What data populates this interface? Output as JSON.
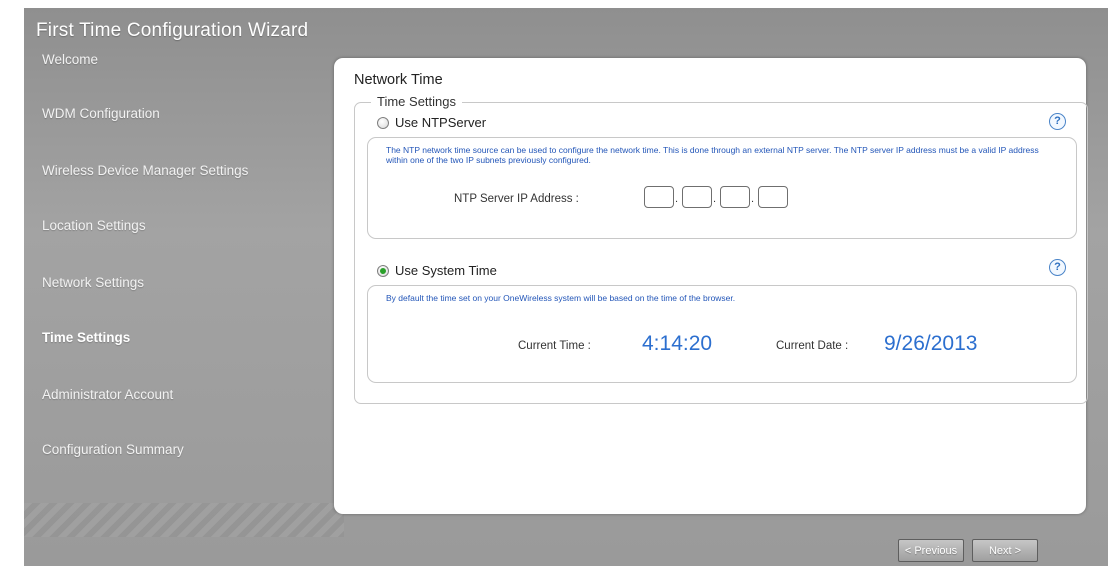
{
  "wizard": {
    "title": "First Time Configuration Wizard"
  },
  "nav": {
    "items": [
      {
        "label": "Welcome"
      },
      {
        "label": "WDM Configuration"
      },
      {
        "label": "Wireless Device Manager Settings"
      },
      {
        "label": "Location Settings"
      },
      {
        "label": "Network Settings"
      },
      {
        "label": "Time Settings",
        "active": true
      },
      {
        "label": "Administrator Account"
      },
      {
        "label": "Configuration Summary"
      }
    ]
  },
  "content": {
    "title": "Network Time",
    "legend": "Time Settings",
    "ntp": {
      "option_label": "Use NTPServer",
      "selected": false,
      "description": "The NTP network time source can be used to configure the network time. This is done through an external NTP server. The NTP server IP address must be a valid IP address within one of the two IP subnets previously configured.",
      "ip_label": "NTP Server IP Address :",
      "ip_octets": [
        "",
        "",
        "",
        ""
      ]
    },
    "system": {
      "option_label": "Use System Time",
      "selected": true,
      "description": "By default the time set on your OneWireless system will be based on the time of the browser.",
      "time_label": "Current Time :",
      "time_value": "4:14:20",
      "date_label": "Current Date :",
      "date_value": "9/26/2013"
    },
    "help_icon": "?"
  },
  "footer": {
    "previous_label": "< Previous",
    "next_label": "Next >"
  },
  "colors": {
    "background_gray": "#9d9d9d",
    "accent_blue": "#2c6fcf",
    "radio_selected": "#2aa02a"
  }
}
